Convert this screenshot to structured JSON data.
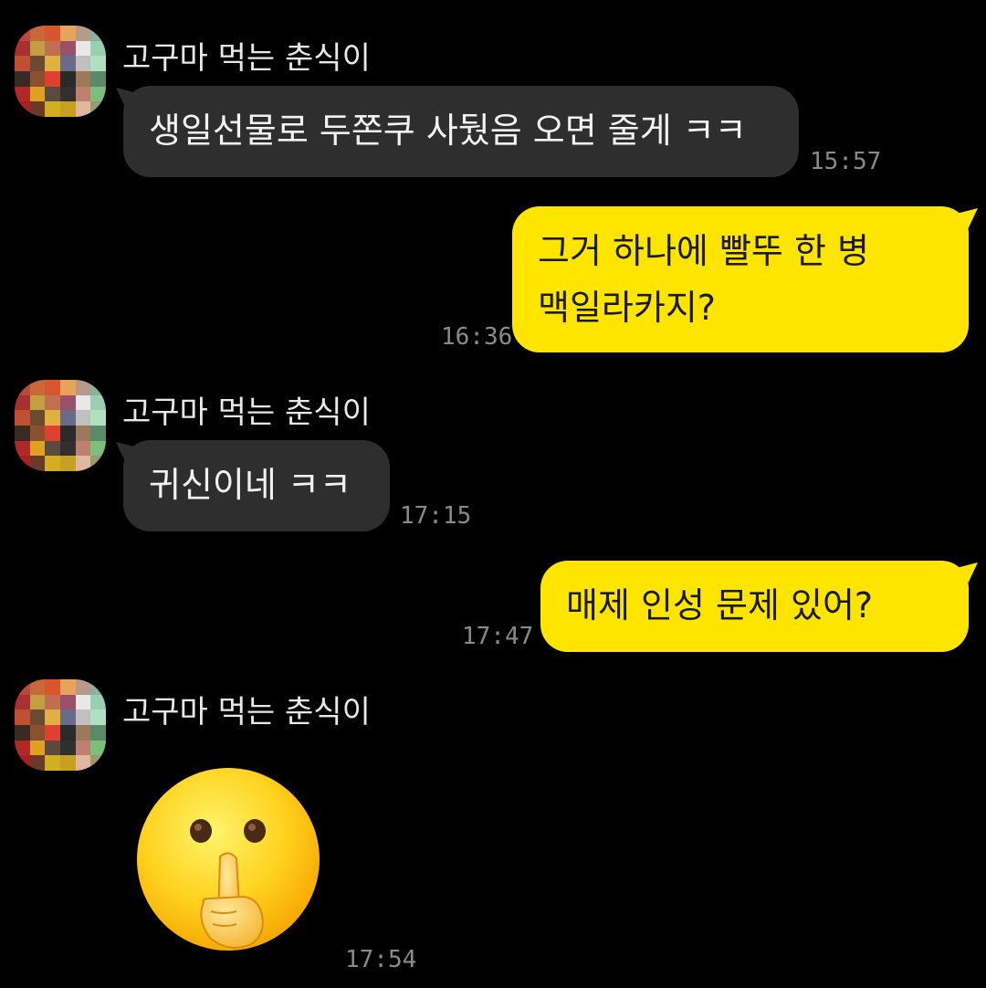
{
  "chat": {
    "messages": [
      {
        "sender": "고구마 먹는 춘식이",
        "text": "생일선물로 두쫀쿠 사뒀음 오면 줄게 ㅋㅋ",
        "time": "15:57"
      },
      {
        "line1": "그거 하나에 빨뚜 한 병",
        "line2": "맥일라카지?",
        "time": "16:36"
      },
      {
        "sender": "고구마 먹는 춘식이",
        "text": "귀신이네 ㅋㅋ",
        "time": "17:15"
      },
      {
        "text": "매제 인성 문제 있어?",
        "time": "17:47"
      },
      {
        "sender": "고구마 먹는 춘식이",
        "emoji": "shushing-face",
        "time": "17:54"
      }
    ]
  },
  "colors": {
    "background": "#000000",
    "incoming_bubble": "#2e2e2e",
    "outgoing_bubble": "#fee500",
    "timestamp": "#8a8a8a"
  }
}
